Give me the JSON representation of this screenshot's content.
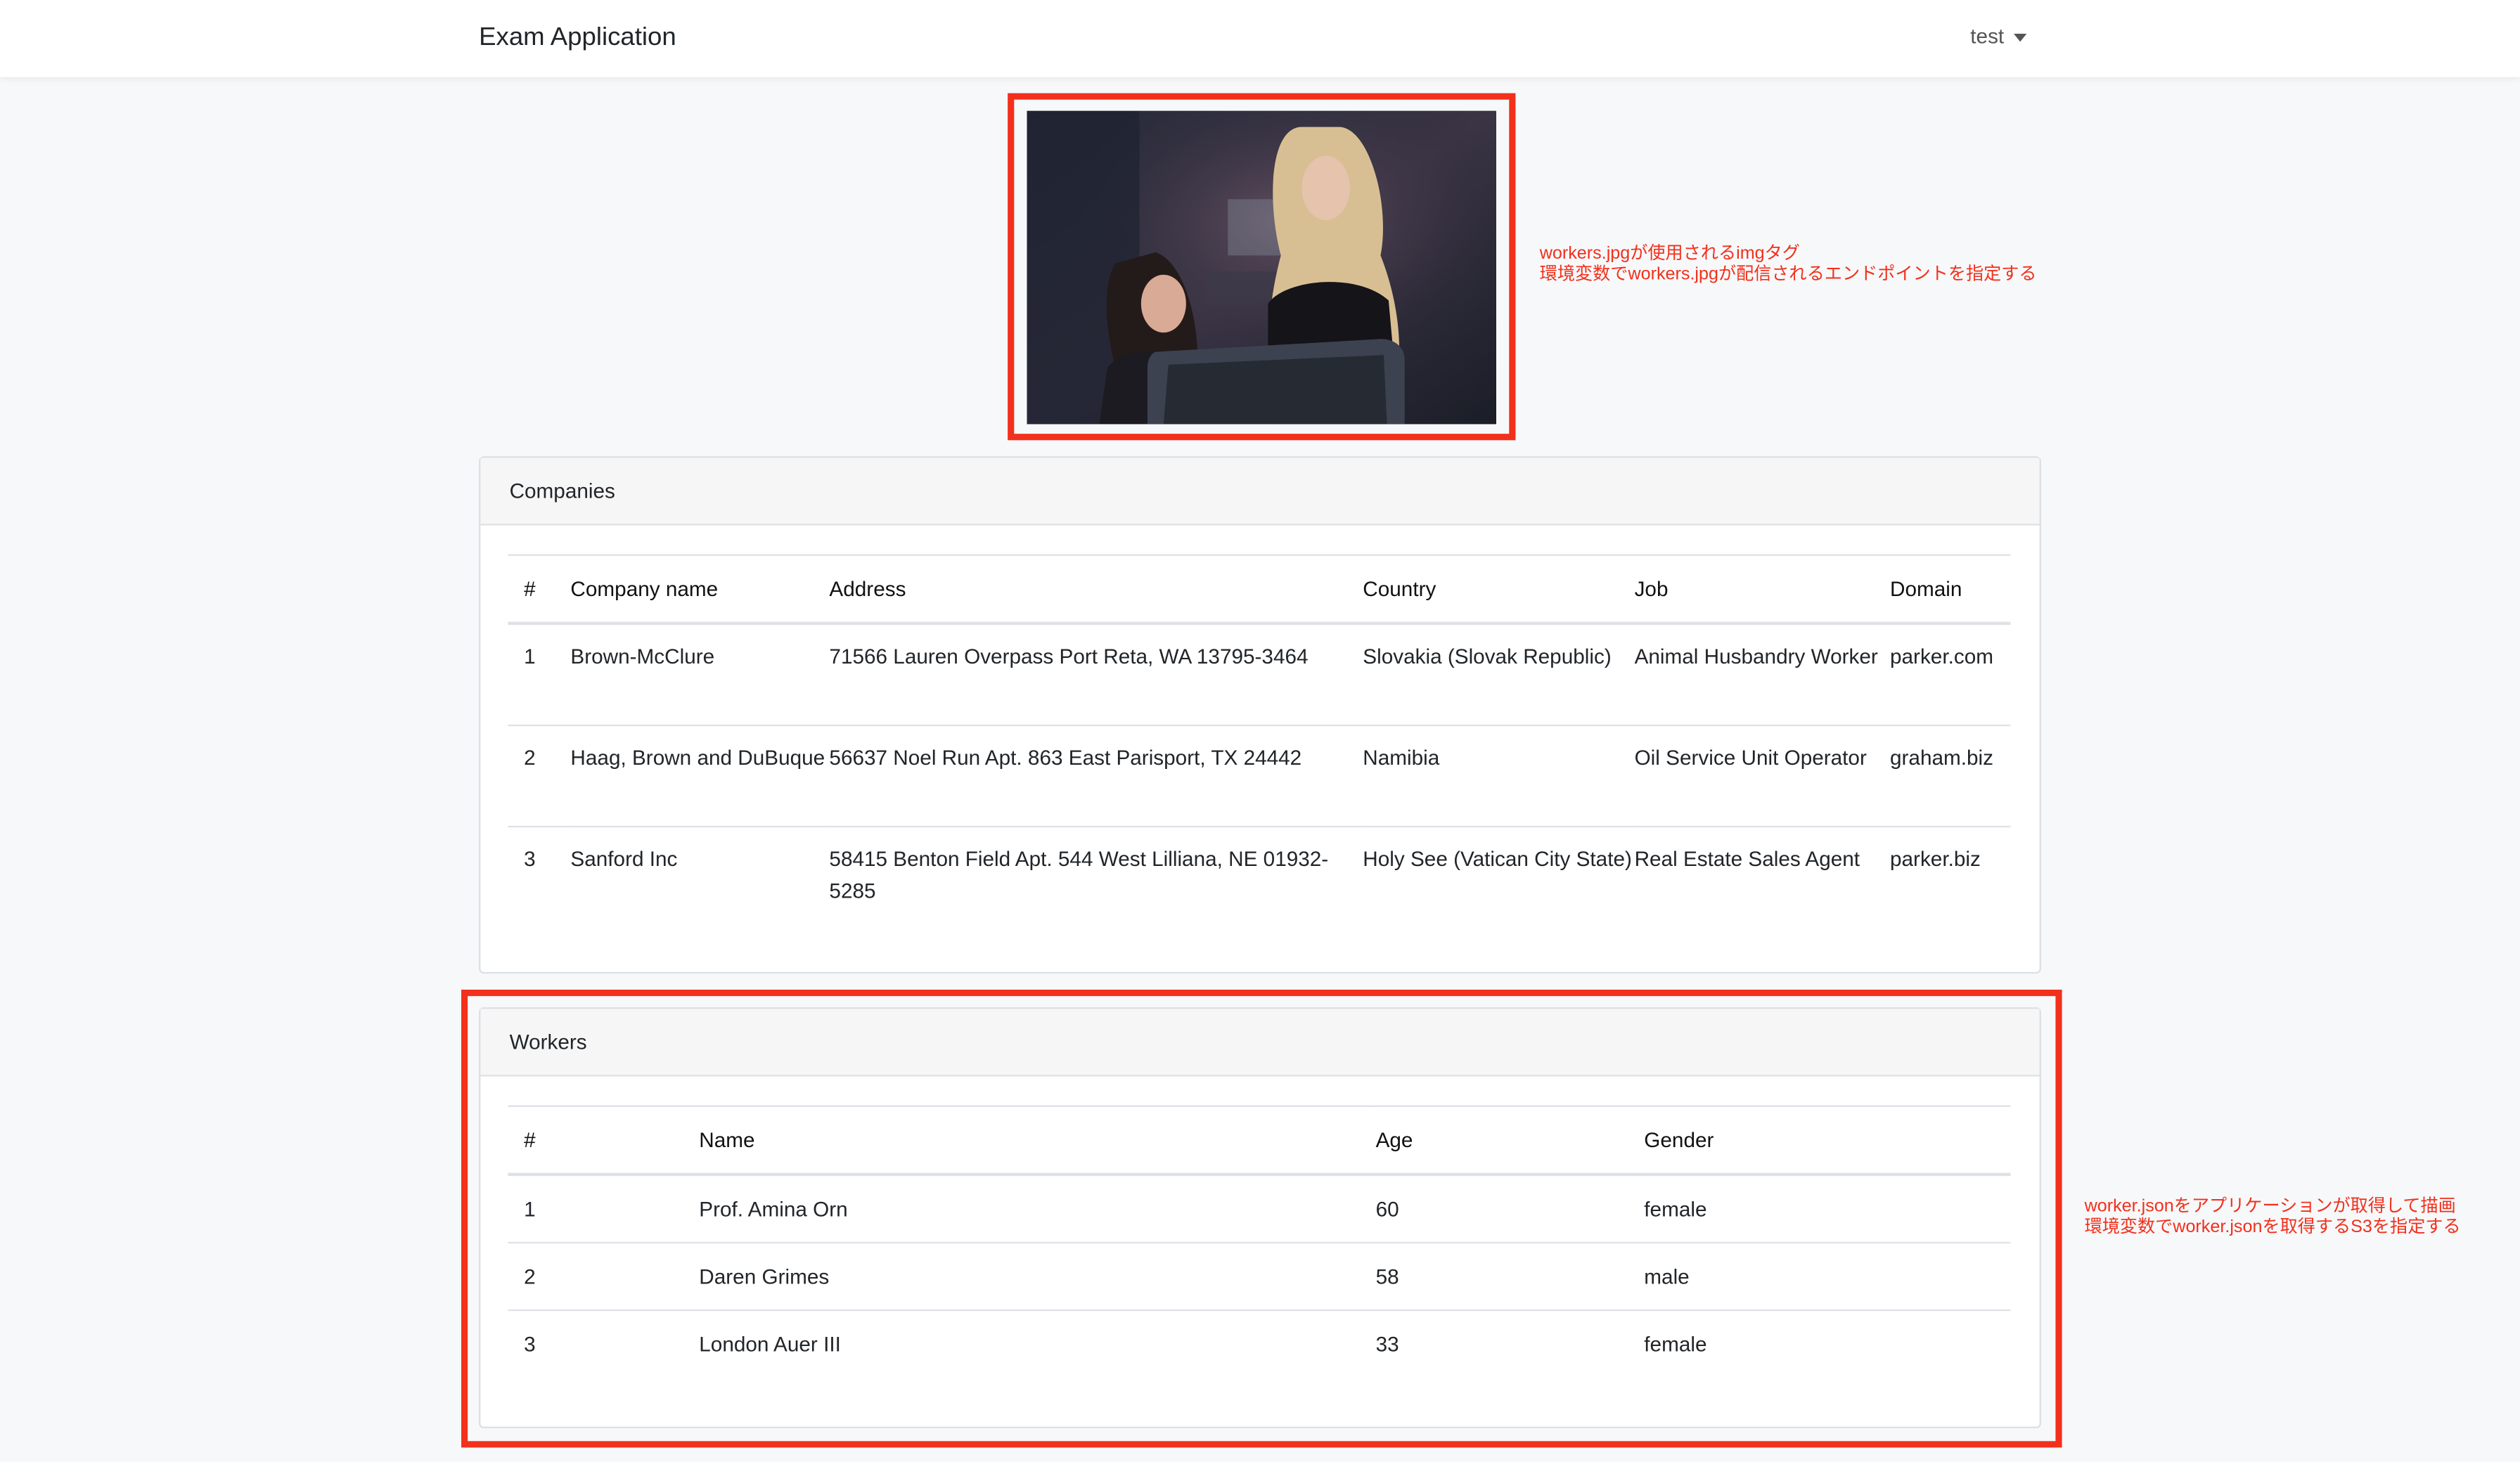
{
  "navbar": {
    "brand": "Exam Application",
    "user": "test"
  },
  "hero": {
    "alt": "workers.jpg",
    "annotation_line1": "workers.jpgが使用されるimgタグ",
    "annotation_line2": "環境変数でworkers.jpgが配信されるエンドポイントを指定する"
  },
  "companies": {
    "title": "Companies",
    "headers": [
      "#",
      "Company name",
      "Address",
      "Country",
      "Job",
      "Domain"
    ],
    "rows": [
      {
        "id": "1",
        "name": "Brown-McClure",
        "address": "71566 Lauren Overpass Port Reta, WA 13795-3464",
        "country": "Slovakia (Slovak Republic)",
        "job": "Animal Husbandry Worker",
        "domain": "parker.com"
      },
      {
        "id": "2",
        "name": "Haag, Brown and DuBuque",
        "address": "56637 Noel Run Apt. 863 East Parisport, TX 24442",
        "country": "Namibia",
        "job": "Oil Service Unit Operator",
        "domain": "graham.biz"
      },
      {
        "id": "3",
        "name": "Sanford Inc",
        "address": "58415 Benton Field Apt. 544 West Lilliana, NE 01932-5285",
        "country": "Holy See (Vatican City State)",
        "job": "Real Estate Sales Agent",
        "domain": "parker.biz"
      }
    ]
  },
  "workers": {
    "title": "Workers",
    "headers": [
      "#",
      "Name",
      "Age",
      "Gender"
    ],
    "rows": [
      {
        "id": "1",
        "name": "Prof. Amina Orn",
        "age": "60",
        "gender": "female"
      },
      {
        "id": "2",
        "name": "Daren Grimes",
        "age": "58",
        "gender": "male"
      },
      {
        "id": "3",
        "name": "London Auer III",
        "age": "33",
        "gender": "female"
      }
    ],
    "annotation_line1": "worker.jsonをアプリケーションが取得して描画",
    "annotation_line2": "環境変数でworker.jsonを取得するS3を指定する"
  },
  "colors": {
    "highlight": "#f2301b",
    "annotation": "#f2301b"
  }
}
